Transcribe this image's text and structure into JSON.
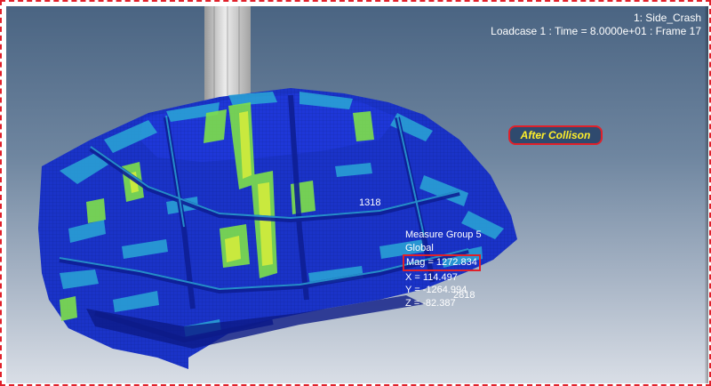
{
  "viewport": {
    "title_line": "1: Side_Crash",
    "loadcase_line": "Loadcase 1 : Time = 8.0000e+01 : Frame 17"
  },
  "annotation": {
    "label": "After Collison"
  },
  "node_labels": {
    "node_a": "1318",
    "node_b": "2818"
  },
  "measure": {
    "group": "Measure Group 5",
    "system": "Global",
    "mag": "Mag = 1272.834",
    "x": "X = 114.497",
    "y": "Y = -1264.994",
    "z": "Z = -82.387"
  },
  "colors": {
    "frame_border": "#e0202a",
    "contour_blue": "#1a33c8",
    "contour_light": "#2aa7d6",
    "contour_green": "#7ee04a",
    "contour_yellow": "#d8ee3a",
    "impactor": "#c9c9c9",
    "label_text": "#ffef2a"
  }
}
